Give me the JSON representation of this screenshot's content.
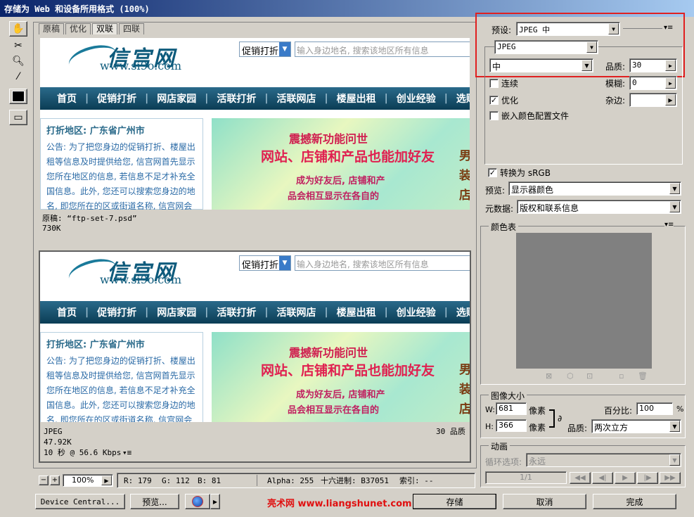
{
  "window": {
    "title": "存储为 Web 和设备所用格式 (100%)"
  },
  "tabs": [
    "原稿",
    "优化",
    "双联",
    "四联"
  ],
  "site": {
    "logo_text": "信宫网",
    "logo_url": "www.si9o.com",
    "select_label": "促销打折",
    "search_placeholder": "输入身边地名, 搜索该地区所有信息",
    "nav": [
      "首页",
      "促销打折",
      "网店家园",
      "活联打折",
      "活联网店",
      "楼屋出租",
      "创业经验",
      "选购常识"
    ],
    "side_title": "打折地区: 广东省广州市",
    "side_text": "公告: 为了把您身边的促销打折、楼屋出租等信息及时提供给您, 信宫网首先显示您所在地区的信息, 若信息不足才补充全国信息。此外, 您还可以搜索您身边的地名, 即您所在的区或街道名称, 信宫网会",
    "banner": {
      "l1": "震撼新功能问世",
      "l2": "网站、店铺和产品也能加好友",
      "l3": "成为好友后, 店铺和产",
      "l4": "品会相互显示在各自的",
      "vert": "男装店"
    }
  },
  "top_pane": {
    "name": "原稿: “ftp-set-7.psd”",
    "size": "730K"
  },
  "bottom_pane": {
    "format": "JPEG",
    "size": "47.92K",
    "time": "10 秒 @ 56.6 Kbps",
    "quality": "30 品质"
  },
  "statusbar": {
    "zoom": "100%",
    "r": "R: 179",
    "g": "G: 112",
    "b": "B: 81",
    "alpha": "Alpha: 255",
    "hex": "十六进制: B37051",
    "index": "索引: --"
  },
  "buttons": {
    "device_central": "Device Central...",
    "preview": "预览...",
    "save": "存储",
    "cancel": "取消",
    "done": "完成"
  },
  "watermark": "亮术网 www.liangshunet.com",
  "settings": {
    "preset_label": "预设:",
    "preset_value": "JPEG 中",
    "format_value": "JPEG",
    "quality_level": "中",
    "quality_label": "品质:",
    "quality_value": "30",
    "progressive_label": "连续",
    "blur_label": "模糊:",
    "blur_value": "0",
    "optimized_label": "优化",
    "matte_label": "杂边:",
    "embed_label": "嵌入颜色配置文件",
    "convert_label": "转换为 sRGB",
    "preview_label": "预览:",
    "preview_value": "显示器颜色",
    "metadata_label": "元数据:",
    "metadata_value": "版权和联系信息"
  },
  "color_table": {
    "title": "颜色表"
  },
  "image_size": {
    "title": "图像大小",
    "w_label": "W:",
    "w_value": "681",
    "h_label": "H:",
    "h_value": "366",
    "unit": "像素",
    "percent_label": "百分比:",
    "percent_value": "100",
    "percent_unit": "%",
    "quality_label": "品质:",
    "quality_value": "两次立方"
  },
  "animation": {
    "title": "动画",
    "loop_label": "循环选项:",
    "loop_value": "永远",
    "frame": "1/1"
  },
  "colors": {
    "highlight_box": "#e02020",
    "nav_bg": "#0b3d55",
    "gray_swatch": "#808080"
  }
}
